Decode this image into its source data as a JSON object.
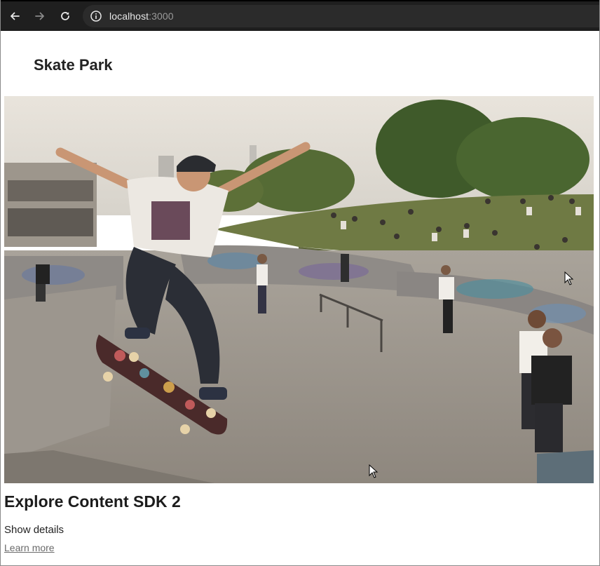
{
  "browser": {
    "url_host": "localhost",
    "url_port": ":3000"
  },
  "page": {
    "site_title": "Skate Park",
    "hero_image_alt": "skate park",
    "card_heading": "Explore Content SDK 2",
    "show_details": "Show details",
    "learn_more": "Learn more"
  },
  "icons": {
    "back": "arrow-left-icon",
    "forward": "arrow-right-icon",
    "reload": "reload-icon",
    "info": "info-icon"
  },
  "colors": {
    "toolbar_bg": "#1f1f1f",
    "omnibox_bg": "#2b2b2b",
    "title_text": "#222222",
    "link_text": "#6a6a6a"
  }
}
